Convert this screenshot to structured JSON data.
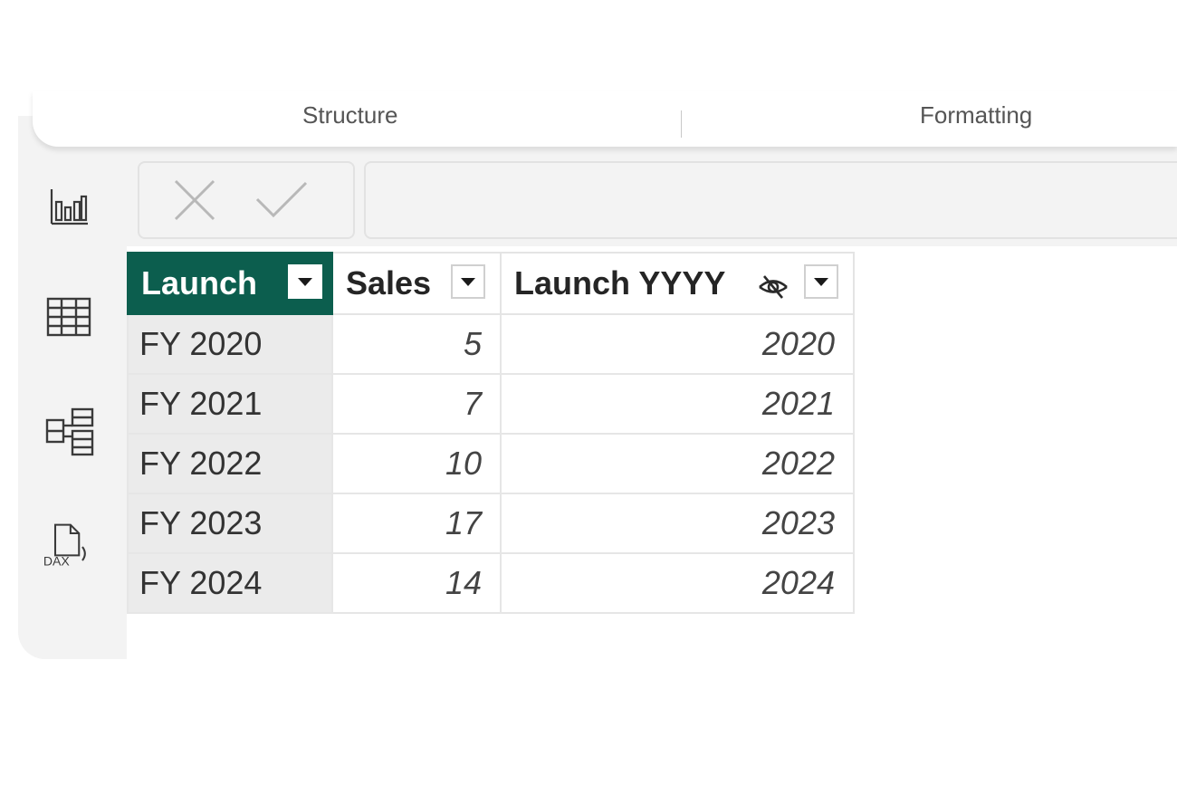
{
  "ribbon": {
    "groups": [
      {
        "label": "Structure"
      },
      {
        "label": "Formatting"
      }
    ]
  },
  "rail": {
    "items": [
      {
        "name": "report-view",
        "icon": "bar-chart-icon"
      },
      {
        "name": "table-view",
        "icon": "table-grid-icon"
      },
      {
        "name": "model-view",
        "icon": "model-diagram-icon"
      },
      {
        "name": "dax-query-view",
        "icon": "dax-file-icon",
        "label": "DAX"
      }
    ]
  },
  "formula_bar": {
    "cancel_icon": "x-icon",
    "commit_icon": "check-icon",
    "value": ""
  },
  "table": {
    "columns": [
      {
        "label": "Launch",
        "selected": true
      },
      {
        "label": "Sales",
        "selected": false
      },
      {
        "label": "Launch YYYY",
        "selected": false,
        "hidden_in_report": true
      }
    ],
    "rows": [
      {
        "launch": "FY 2020",
        "sales": "5",
        "launch_yyyy": "2020"
      },
      {
        "launch": "FY 2021",
        "sales": "7",
        "launch_yyyy": "2021"
      },
      {
        "launch": "FY 2022",
        "sales": "10",
        "launch_yyyy": "2022"
      },
      {
        "launch": "FY 2023",
        "sales": "17",
        "launch_yyyy": "2023"
      },
      {
        "launch": "FY 2024",
        "sales": "14",
        "launch_yyyy": "2024"
      }
    ]
  },
  "colors": {
    "selected_header": "#0c5e4e",
    "key_column_bg": "#ebebeb",
    "frame_bg": "#f3f3f3"
  }
}
